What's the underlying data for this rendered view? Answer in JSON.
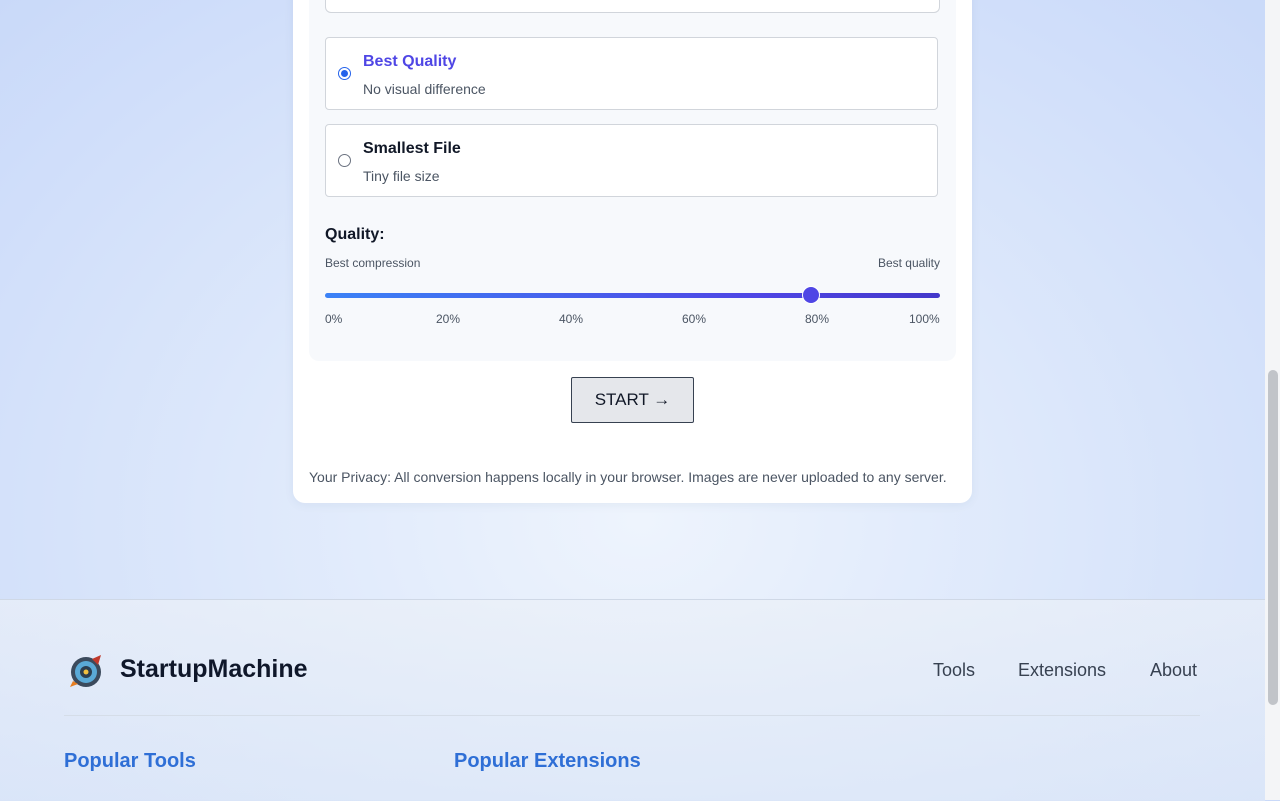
{
  "compression": {
    "options": [
      {
        "title": "Best Quality",
        "subtitle": "No visual difference",
        "selected": true
      },
      {
        "title": "Smallest File",
        "subtitle": "Tiny file size",
        "selected": false
      }
    ],
    "quality_label": "Quality:",
    "left_hint": "Best compression",
    "right_hint": "Best quality",
    "slider_value_percent": 79,
    "ticks": [
      "0%",
      "20%",
      "40%",
      "60%",
      "80%",
      "100%"
    ]
  },
  "start_button": "START →",
  "privacy_text": "Your Privacy: All conversion happens locally in your browser. Images are never uploaded to any server.",
  "footer": {
    "brand": "StartupMachine",
    "nav": [
      "Tools",
      "Extensions",
      "About"
    ],
    "columns": [
      "Popular Tools",
      "Popular Extensions"
    ]
  },
  "colors": {
    "accent": "#4f46e5",
    "radio": "#2563eb",
    "footer_heading": "#2f6fd6"
  }
}
